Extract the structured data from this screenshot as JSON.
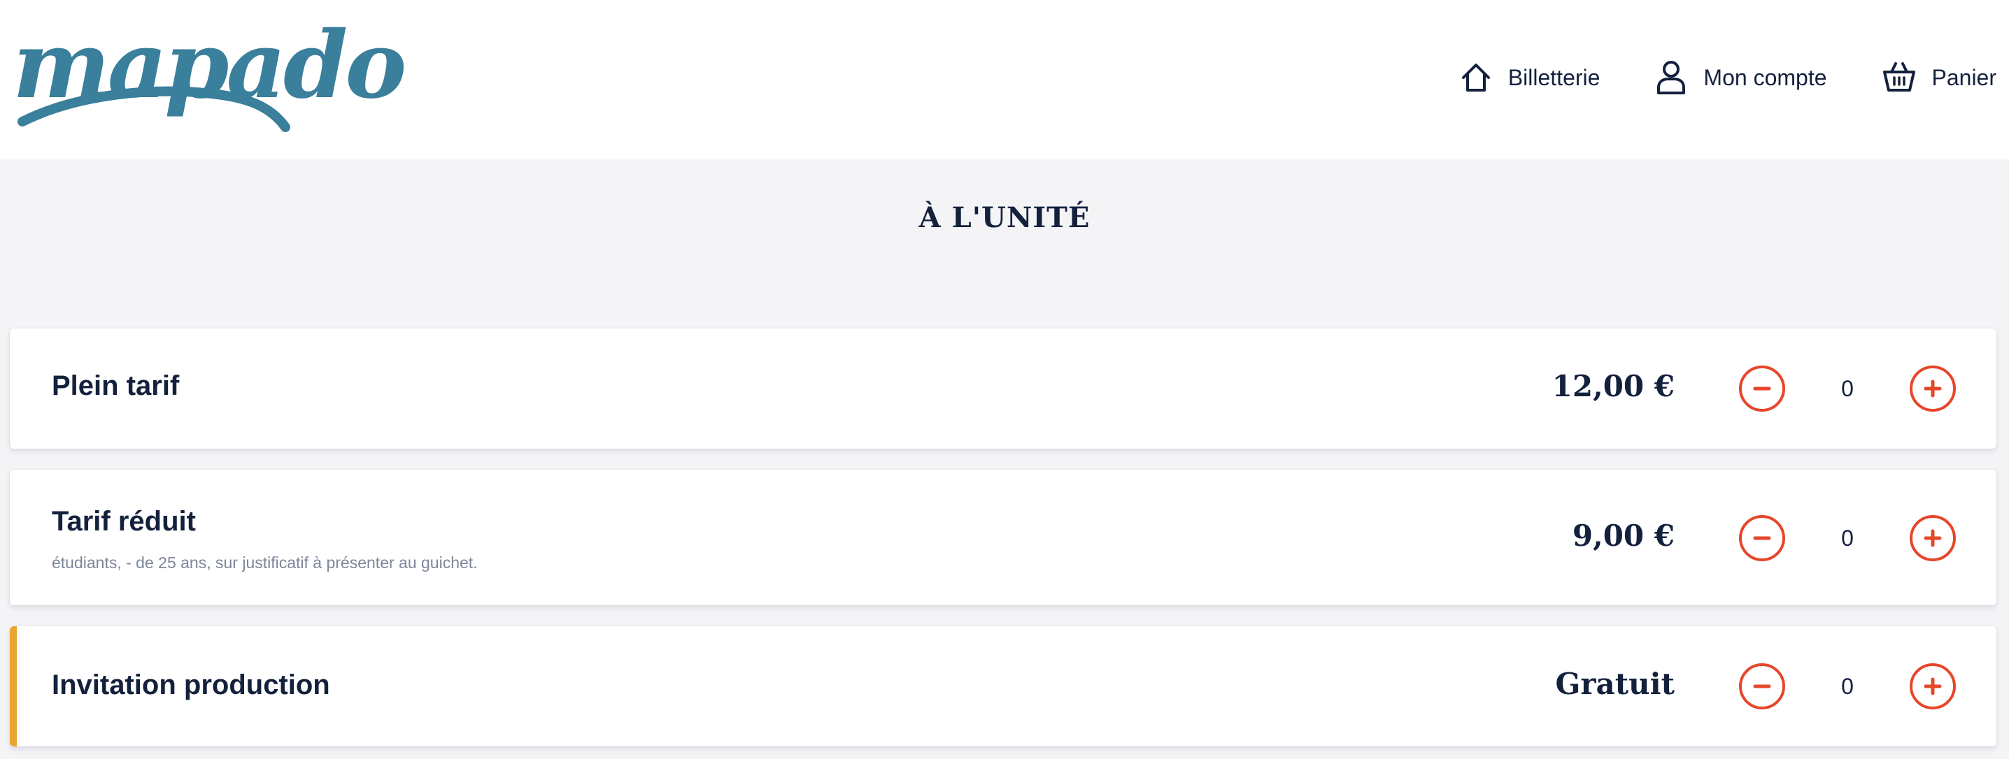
{
  "header": {
    "logo_text": "mapado",
    "nav": [
      {
        "label": "Billetterie",
        "icon": "home-icon"
      },
      {
        "label": "Mon compte",
        "icon": "user-icon"
      },
      {
        "label": "Panier",
        "icon": "basket-icon"
      }
    ]
  },
  "section": {
    "title": "À L'UNITÉ"
  },
  "tariffs": [
    {
      "name": "Plein tarif",
      "description": "",
      "price": "12,00 €",
      "quantity": "0"
    },
    {
      "name": "Tarif réduit",
      "description": "étudiants, - de 25 ans, sur justificatif à présenter au guichet.",
      "price": "9,00 €",
      "quantity": "0"
    },
    {
      "name": "Invitation production",
      "description": "",
      "price": "Gratuit",
      "quantity": "0",
      "accent": true
    }
  ],
  "colors": {
    "brand": "#3a7f9b",
    "text": "#14213d",
    "action": "#e6472a",
    "accent": "#e8a531",
    "background": "#f4f4f7"
  }
}
